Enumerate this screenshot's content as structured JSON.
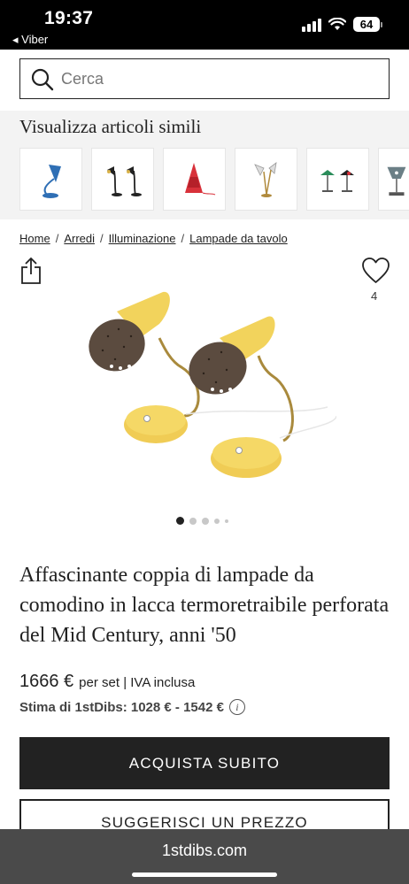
{
  "status_bar": {
    "time": "19:37",
    "back_app": "◂ Viber",
    "battery": "64"
  },
  "search": {
    "placeholder": "Cerca"
  },
  "similar": {
    "heading": "Visualizza articoli simili",
    "thumbnails": [
      "blue-lamp",
      "black-lamp-pair",
      "red-lamp",
      "white-lamp",
      "multicolor-lamp-pair",
      "grey-lamp"
    ]
  },
  "breadcrumb": [
    "Home",
    "Arredi",
    "Illuminazione",
    "Lampade da tavolo"
  ],
  "favorites": {
    "count": "4"
  },
  "carousel": {
    "slides": 5,
    "active_index": 0
  },
  "product": {
    "title": "Affascinante coppia di lampade da comodino in lacca termoretraibile perforata del Mid Century, anni '50",
    "price": "1666 €",
    "price_note": "per set | IVA inclusa",
    "estimate": "Stima di 1stDibs: 1028 € - 1542 €"
  },
  "buttons": {
    "buy": "ACQUISTA SUBITO",
    "offer": "SUGGERISCI UN PREZZO"
  },
  "browser": {
    "url": "1stdibs.com"
  },
  "colors": {
    "dark": "#222222",
    "similar_bg": "#f3f3f3",
    "lamp_yellow": "#f2d35c",
    "lamp_brown": "#5b4b3f",
    "bottom_bar": "#4a4a4a"
  }
}
